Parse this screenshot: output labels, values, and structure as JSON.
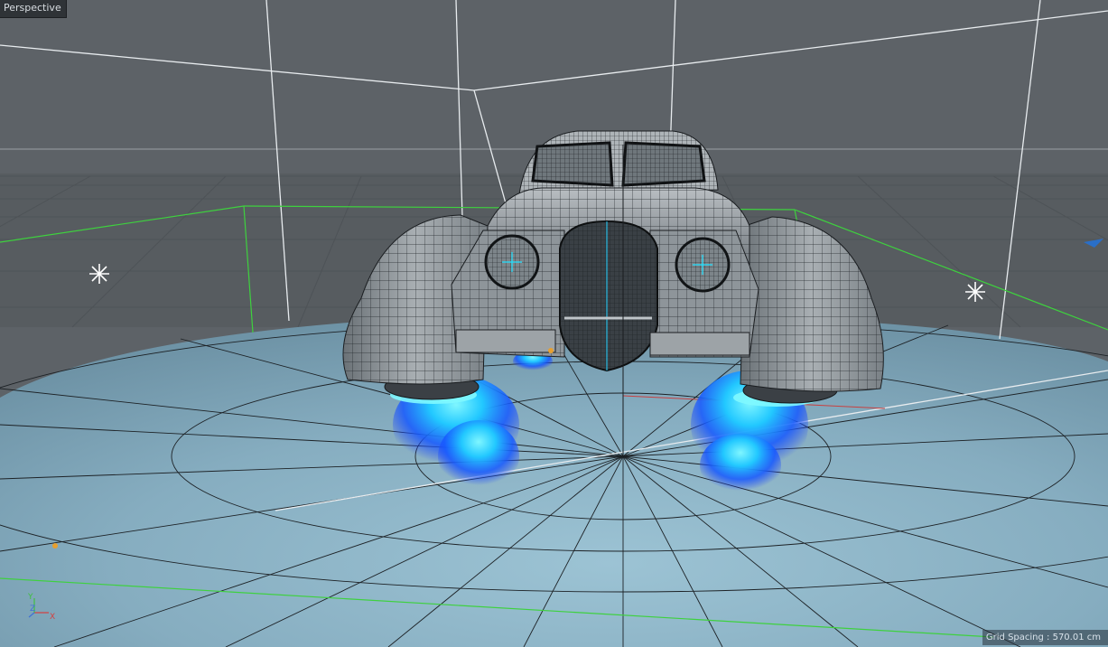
{
  "viewport": {
    "view_name": "Perspective",
    "grid_spacing_text": "Grid Spacing : 570.01 cm"
  },
  "axis_gizmo": {
    "y_label": "Y",
    "z_label": "Z",
    "x_label": "X"
  },
  "colors": {
    "background": "#5c6166",
    "floor": "#8fb6c9",
    "wireframe": "#1a1d20",
    "selection_box": "#3ed13e",
    "exhaust_flame": "#1a7dff",
    "axis_x": "#d44040",
    "axis_y": "#40c040",
    "axis_z": "#4070d4"
  },
  "icons": {
    "light_left": "light-star-icon",
    "light_right": "light-star-icon",
    "camera_marker": "camera-marker-icon"
  }
}
